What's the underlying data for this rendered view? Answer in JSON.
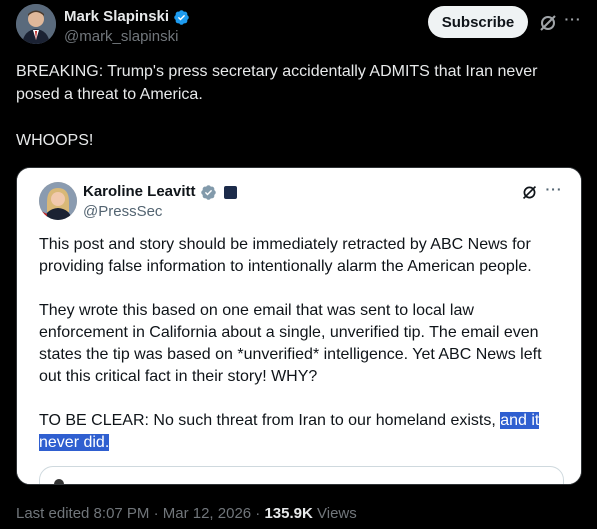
{
  "author": {
    "name": "Mark Slapinski",
    "handle": "@mark_slapinski"
  },
  "actions": {
    "subscribe_label": "Subscribe",
    "more_label": "···"
  },
  "tweet": {
    "lines": [
      "BREAKING: Trump's press secretary accidentally ADMITS that Iran never posed a threat to America.",
      "WHOOPS!"
    ]
  },
  "quoted": {
    "name": "Karoline Leavitt",
    "handle": "@PressSec",
    "more_label": "···",
    "paragraph1": "This post and story should be immediately retracted by ABC News for providing false information to intentionally alarm the American people.",
    "paragraph2": "They wrote this based on one email that was sent to local law enforcement in California about a single, unverified tip. The email even states the tip was based on *unverified* intelligence. Yet ABC News left out this critical fact in their story! WHY?",
    "paragraph3_plain": "TO BE CLEAR: No such threat from Iran to our homeland exists, ",
    "paragraph3_highlight": "and it never did."
  },
  "meta": {
    "edited": "Last edited 8:07 PM · Mar 12, 2026 · ",
    "views_count": "135.9K",
    "views_label": " Views"
  },
  "colors": {
    "background": "#000000",
    "verified_blue": "#1d9bf0",
    "highlight": "#2f5fd0"
  }
}
